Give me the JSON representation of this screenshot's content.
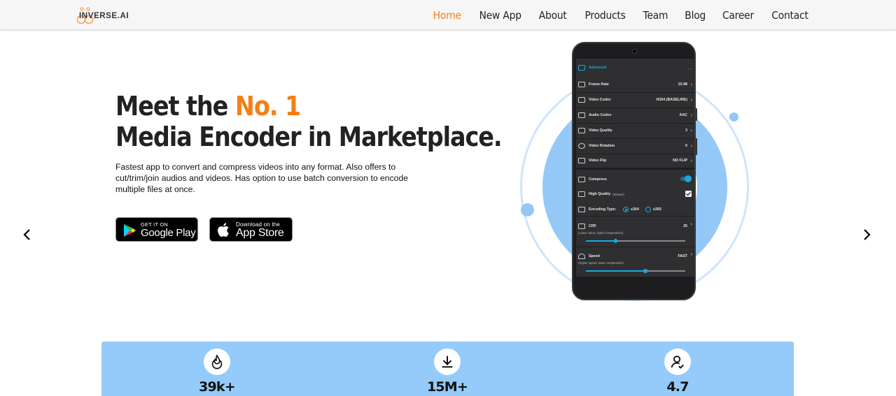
{
  "brand": {
    "name": "INVERSE.AI"
  },
  "nav": {
    "items": [
      {
        "label": "Home",
        "active": true
      },
      {
        "label": "New App",
        "active": false
      },
      {
        "label": "About",
        "active": false
      },
      {
        "label": "Products",
        "active": false
      },
      {
        "label": "Team",
        "active": false
      },
      {
        "label": "Blog",
        "active": false
      },
      {
        "label": "Career",
        "active": false
      },
      {
        "label": "Contact",
        "active": false
      }
    ]
  },
  "hero": {
    "title_prefix": "Meet the ",
    "title_accent": "No. 1",
    "title_line2": "Media Encoder in Marketplace.",
    "description": "Fastest app to convert and compress videos into any format. Also offers to cut/trim/join audios and videos. Has option to use batch conversion to encode multiple files at once."
  },
  "store_buttons": {
    "google": {
      "small": "GET IT ON",
      "big": "Google Play"
    },
    "apple": {
      "small": "Download on the",
      "big": "App Store"
    }
  },
  "phone_screen": {
    "section": "Advanced",
    "rows": [
      {
        "label": "Frame Rate",
        "value": "23.98"
      },
      {
        "label": "Video Codec",
        "value": "H264 (BASELINE)"
      },
      {
        "label": "Audio Codec",
        "value": "AAC"
      },
      {
        "label": "Video Quality",
        "value": "3"
      },
      {
        "label": "Video Rotation",
        "value": "0"
      },
      {
        "label": "Video Flip",
        "value": "NO FLIP"
      }
    ],
    "compress_label": "Compress",
    "high_quality_label": "High Quality",
    "high_quality_note": "(Slower)",
    "encoding_label": "Encoding Type:",
    "encoding_options": [
      "x264",
      "x265"
    ],
    "crf_label": "CRF",
    "crf_value": "25",
    "crf_note": "(Lower value, higher compression)",
    "crf_level": 0.3,
    "speed_label": "Speed",
    "speed_value": "FAST",
    "speed_note": "(Higher speed, lower compression)",
    "speed_level": 0.6
  },
  "colors": {
    "accent": "#f47f16",
    "light_blue": "#94c8f6",
    "toggle_blue": "#1aa7e0"
  },
  "stats": [
    {
      "icon": "fire-icon",
      "value": "39k+"
    },
    {
      "icon": "download-icon",
      "value": "15M+"
    },
    {
      "icon": "user-check-icon",
      "value": "4.7"
    }
  ]
}
